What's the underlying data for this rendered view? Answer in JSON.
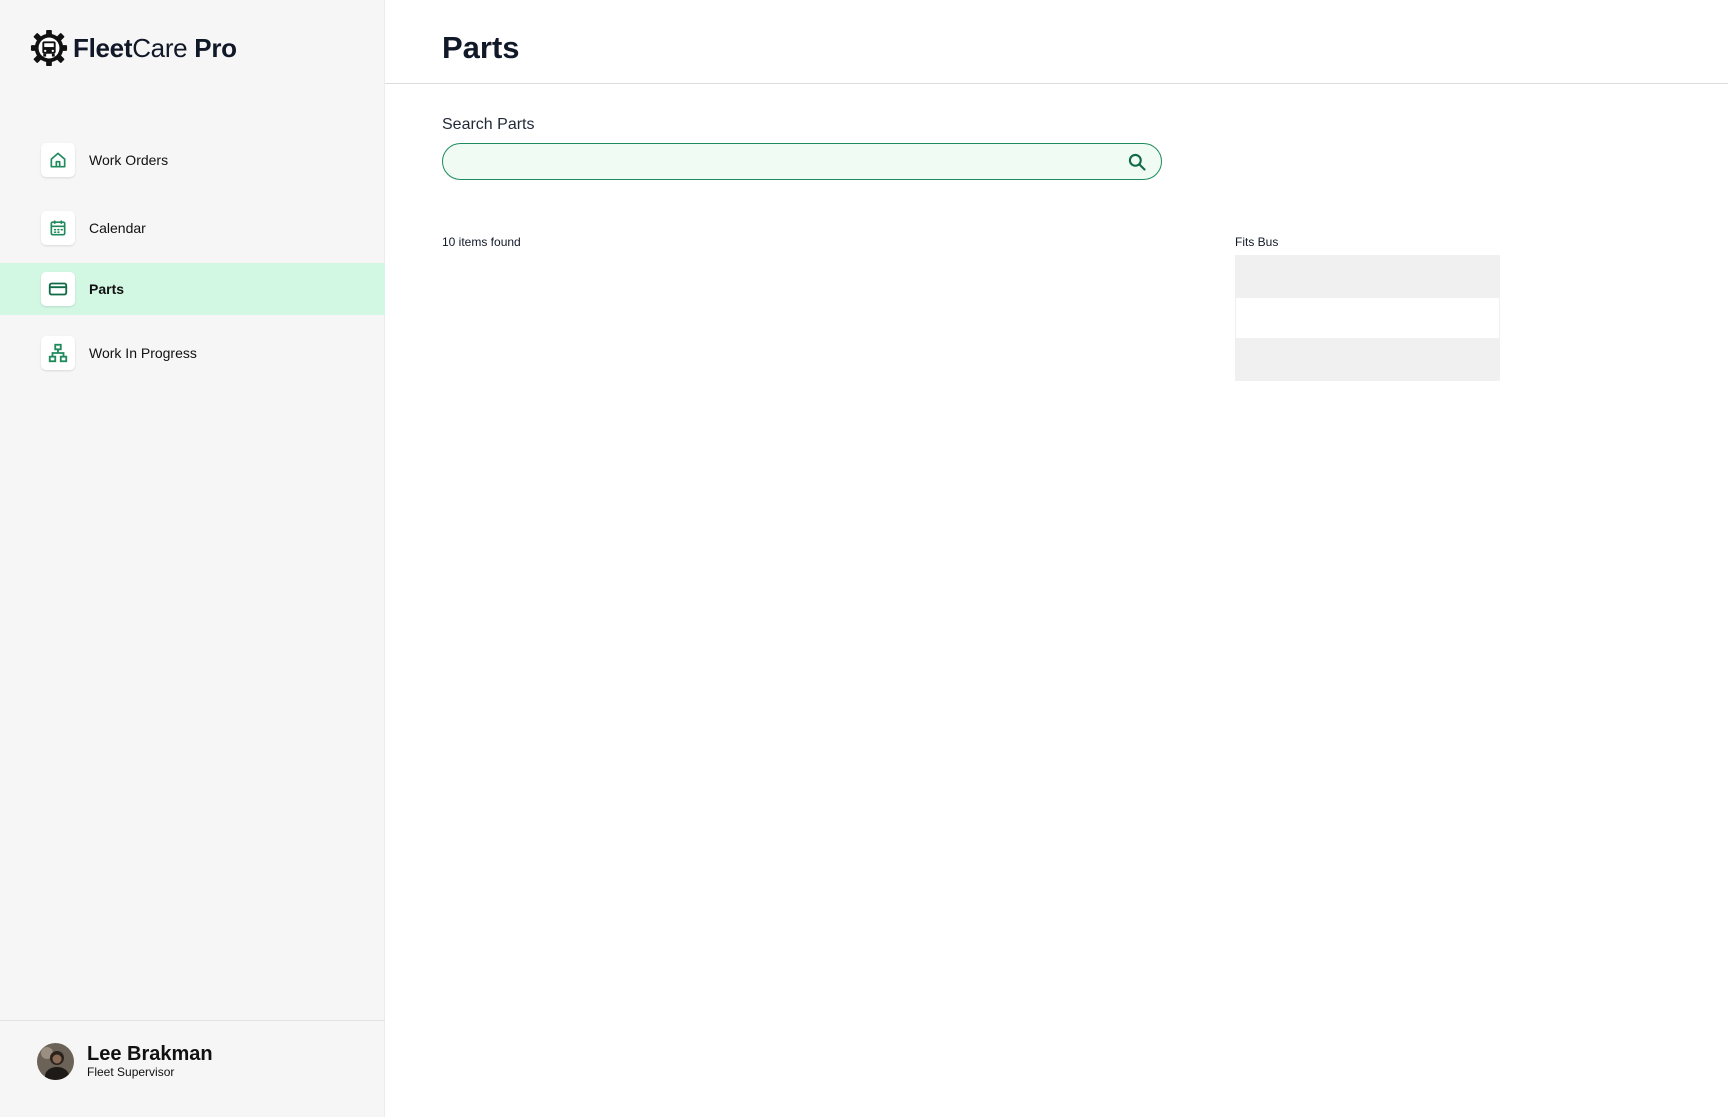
{
  "brand": {
    "name_bold": "Fleet",
    "name_regular": "Care",
    "name_suffix": "Pro",
    "logo_icon": "gear-bus-icon"
  },
  "sidebar": {
    "items": [
      {
        "label": "Work Orders",
        "icon": "home-icon",
        "active": false
      },
      {
        "label": "Calendar",
        "icon": "calendar-icon",
        "active": false
      },
      {
        "label": "Parts",
        "icon": "credit-card-icon",
        "active": true
      },
      {
        "label": "Work In Progress",
        "icon": "hierarchy-icon",
        "active": false
      }
    ]
  },
  "user": {
    "name": "Lee Brakman",
    "role": "Fleet Supervisor"
  },
  "header": {
    "title": "Parts"
  },
  "search": {
    "label": "Search Parts",
    "value": "",
    "placeholder": ""
  },
  "results": {
    "count_text": "10 items found"
  },
  "fits_bus": {
    "label": "Fits Bus",
    "rows": [
      "",
      "",
      ""
    ]
  },
  "colors": {
    "accent": "#1f8a5c",
    "active_bg": "#d2f8e4",
    "sidebar_bg": "#f6f6f6",
    "search_bg": "#f0fbf4"
  }
}
